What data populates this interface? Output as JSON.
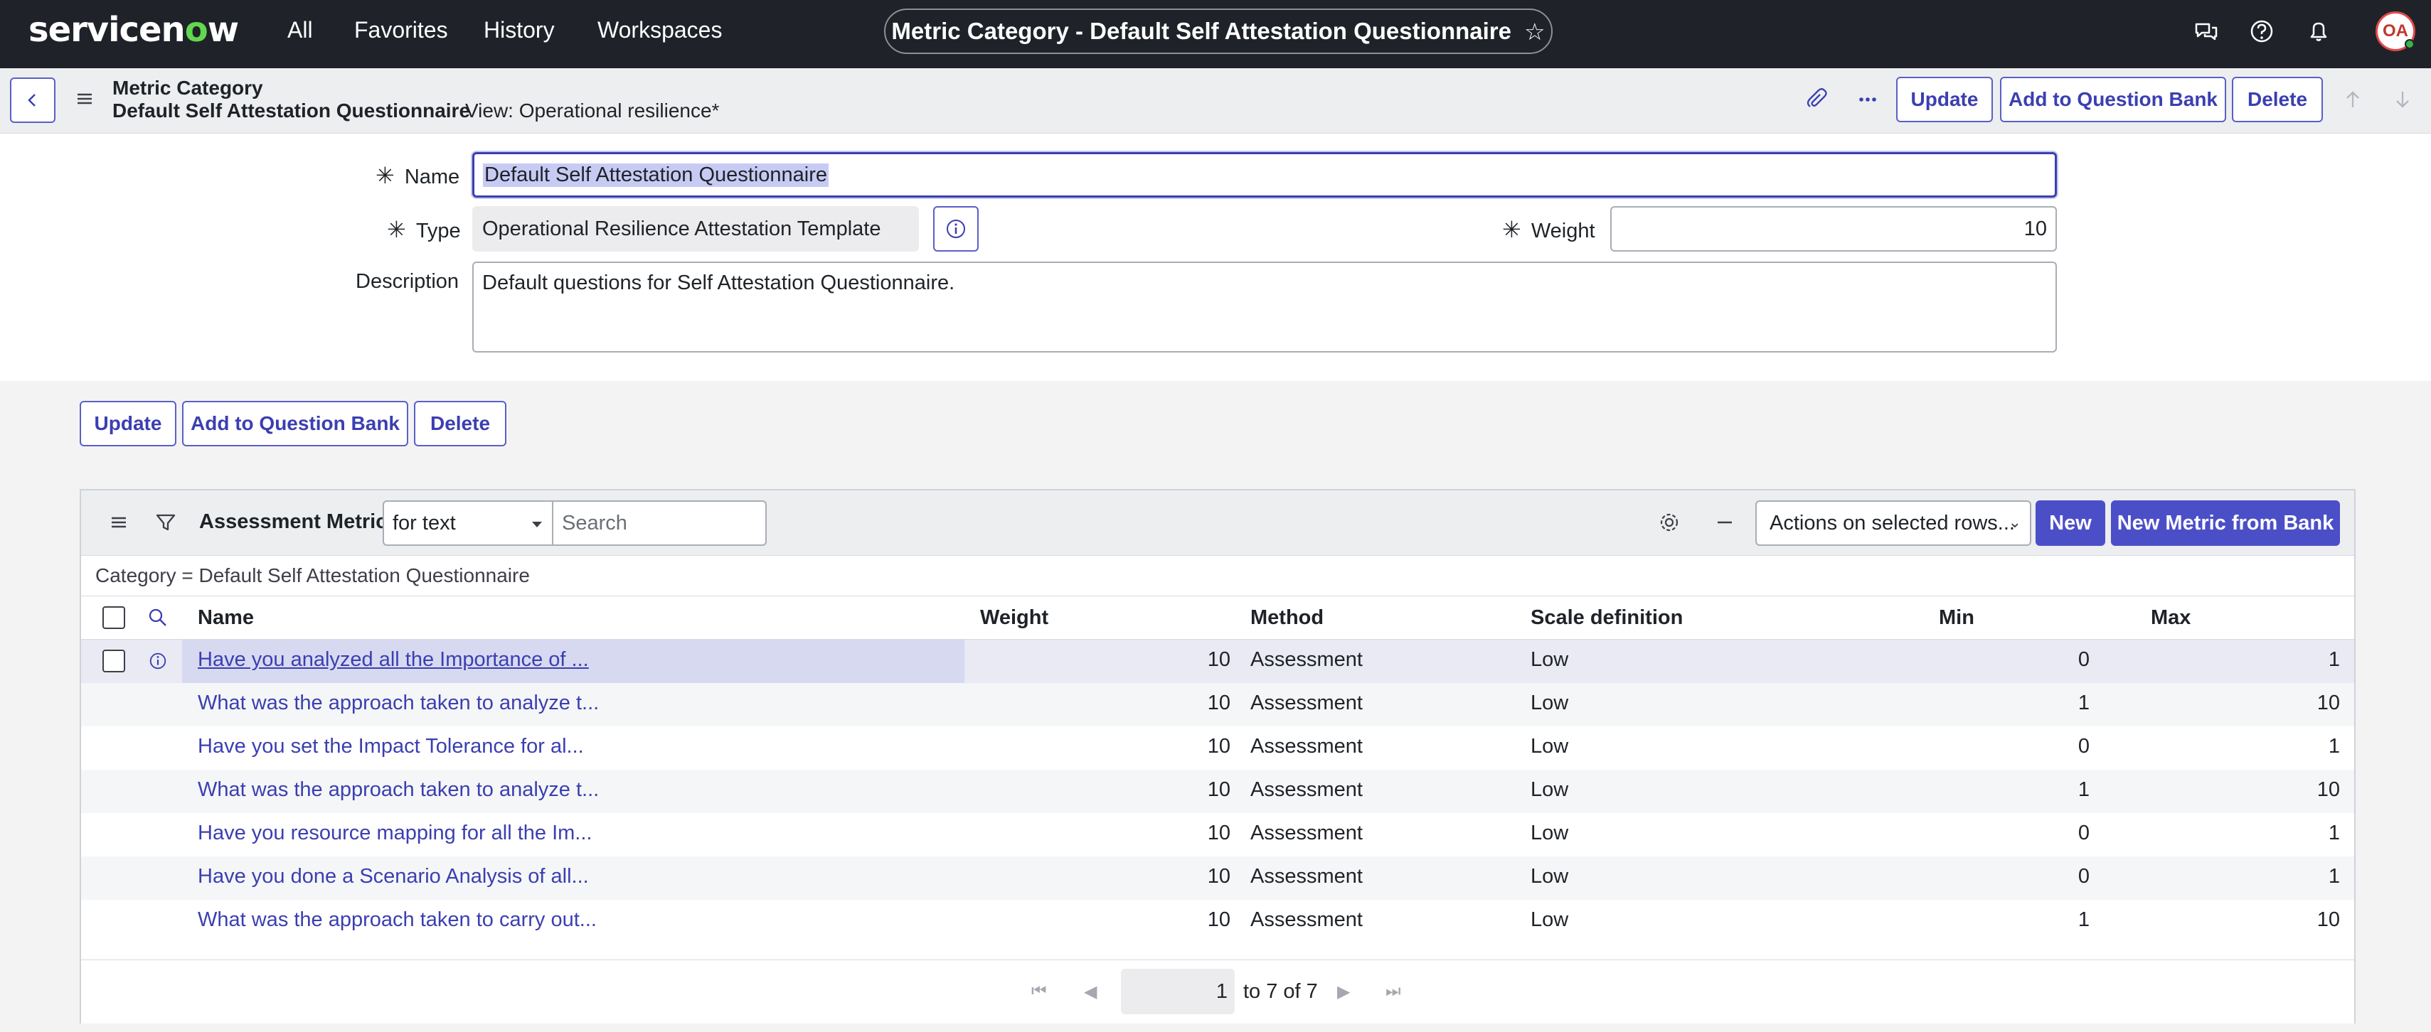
{
  "nav": {
    "logo": "servicenow",
    "links": [
      "All",
      "Favorites",
      "History",
      "Workspaces"
    ],
    "title": "Metric Category - Default Self Attestation Questionnaire",
    "avatar_initials": "OA",
    "icons": [
      "chat-icon",
      "help-icon",
      "bell-icon"
    ]
  },
  "header": {
    "record_type": "Metric Category",
    "record_name": "Default Self Attestation Questionnaire",
    "view": "View: Operational resilience*",
    "buttons": {
      "update": "Update",
      "add_bank": "Add to Question Bank",
      "delete": "Delete"
    }
  },
  "form": {
    "name_label": "Name",
    "name_value": "Default Self Attestation Questionnaire",
    "type_label": "Type",
    "type_value": "Operational Resilience Attestation Template",
    "weight_label": "Weight",
    "weight_value": "10",
    "description_label": "Description",
    "description_value": "Default questions for Self Attestation Questionnaire."
  },
  "actions": {
    "update": "Update",
    "add_bank": "Add to Question Bank",
    "delete": "Delete"
  },
  "list": {
    "title": "Assessment Metrics",
    "search_field": "for text",
    "search_placeholder": "Search",
    "actions_select": "Actions on selected rows...",
    "new_button": "New",
    "new_from_bank_button": "New Metric from Bank",
    "breadcrumb": "Category = Default Self Attestation Questionnaire",
    "columns": [
      "Name",
      "Weight",
      "Method",
      "Scale definition",
      "Min",
      "Max"
    ],
    "rows": [
      {
        "name": "Have you analyzed all the Importance of ...",
        "weight": "10",
        "method": "Assessment",
        "scale": "Low",
        "min": "0",
        "max": "1"
      },
      {
        "name": "What was the approach taken to analyze t...",
        "weight": "10",
        "method": "Assessment",
        "scale": "Low",
        "min": "1",
        "max": "10"
      },
      {
        "name": "Have you set the Impact Tolerance for al...",
        "weight": "10",
        "method": "Assessment",
        "scale": "Low",
        "min": "0",
        "max": "1"
      },
      {
        "name": "What was the approach taken to analyze t...",
        "weight": "10",
        "method": "Assessment",
        "scale": "Low",
        "min": "1",
        "max": "10"
      },
      {
        "name": "Have you resource mapping for all the Im...",
        "weight": "10",
        "method": "Assessment",
        "scale": "Low",
        "min": "0",
        "max": "1"
      },
      {
        "name": "Have you done a Scenario Analysis of all...",
        "weight": "10",
        "method": "Assessment",
        "scale": "Low",
        "min": "0",
        "max": "1"
      },
      {
        "name": "What was the approach taken to carry out...",
        "weight": "10",
        "method": "Assessment",
        "scale": "Low",
        "min": "1",
        "max": "10"
      }
    ],
    "pager": {
      "page_value": "1",
      "range_text": "to 7 of 7"
    }
  }
}
